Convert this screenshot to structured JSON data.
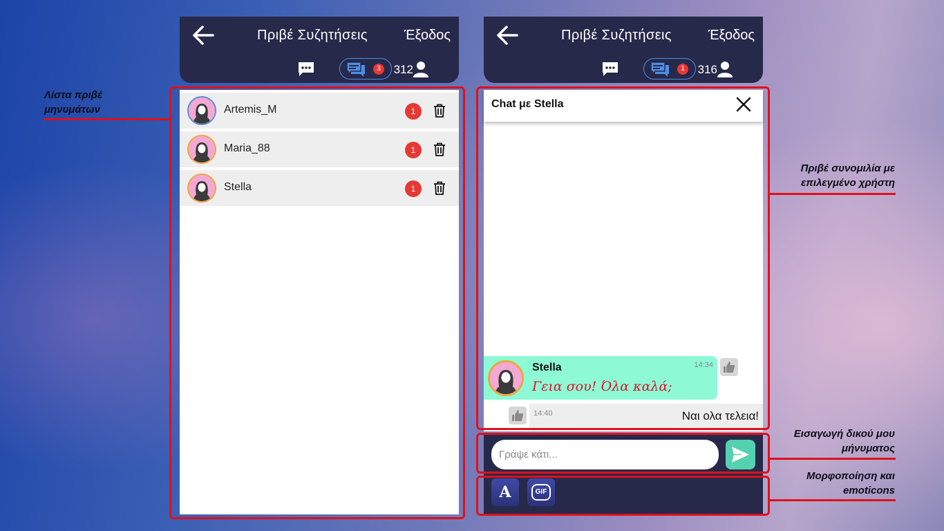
{
  "left_screen": {
    "header": {
      "title": "Πριβέ Συζητήσεις",
      "exit_label": "Έξοδος",
      "pm_badge": "3",
      "user_count": "312"
    },
    "conversations": [
      {
        "name": "Artemis_M",
        "unread": "1"
      },
      {
        "name": "Maria_88",
        "unread": "1"
      },
      {
        "name": "Stella",
        "unread": "1"
      }
    ]
  },
  "right_screen": {
    "header": {
      "title": "Πριβέ Συζητήσεις",
      "exit_label": "Έξοδος",
      "pm_badge": "1",
      "user_count": "316"
    },
    "chat": {
      "title": "Chat με Stella",
      "messages": [
        {
          "sender": "Stella",
          "time": "14:34",
          "text": "Γεια σου! Όλα καλά;"
        },
        {
          "time": "14:40",
          "text": "Ναι ολα τελεια!"
        }
      ]
    },
    "input": {
      "placeholder": "Γράψε κάτι...",
      "value": ""
    },
    "format_bar": {
      "font_button": "A",
      "gif_button": "GIF"
    }
  },
  "annotations": {
    "private_list": [
      "Λίστα πριβέ",
      "μηνυμάτων"
    ],
    "private_chat": [
      "Πριβέ συνομιλία με",
      "επιλεγμένο χρήστη"
    ],
    "message_input": [
      "Εισαγωγή δικού μου",
      "μήνυματος"
    ],
    "formatting": [
      "Μορφοποίηση και",
      "emoticons"
    ]
  },
  "colors": {
    "header_bg": "#27294a",
    "badge_red": "#e53935",
    "incoming_bubble": "#8dfad5",
    "incoming_text": "#e0102a",
    "send_button": "#54d1ae",
    "highlight_red": "#e0101a"
  },
  "icons": [
    "back-arrow-icon",
    "chat-icon",
    "private-messages-icon",
    "user-icon",
    "trash-icon",
    "close-icon",
    "thumbs-up-icon",
    "send-icon",
    "font-icon",
    "gif-icon"
  ]
}
